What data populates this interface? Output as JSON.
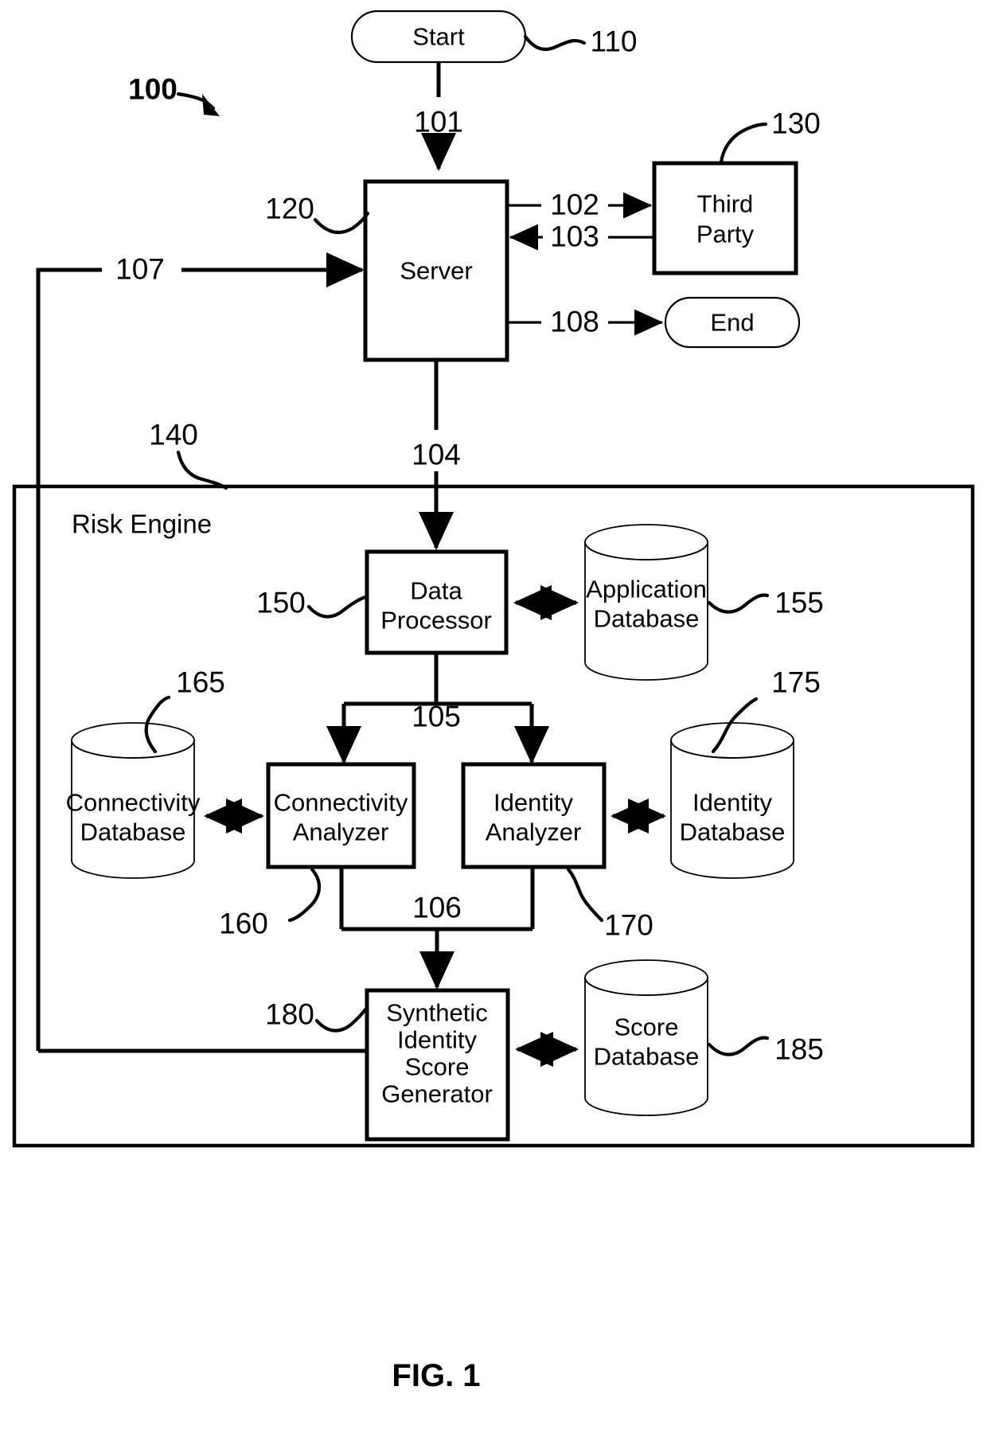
{
  "figure": {
    "caption": "FIG. 1",
    "system_reference": "100"
  },
  "nodes": {
    "start": {
      "label": "Start",
      "ref": "110",
      "shape": "terminator"
    },
    "server": {
      "label": "Server",
      "ref": "120",
      "shape": "rectangle"
    },
    "third_party": {
      "label_line1": "Third",
      "label_line2": "Party",
      "ref": "130",
      "shape": "rectangle"
    },
    "end": {
      "label": "End",
      "ref": "",
      "shape": "terminator"
    },
    "risk_engine": {
      "label": "Risk Engine",
      "ref": "140",
      "shape": "container"
    },
    "data_processor": {
      "label_line1": "Data",
      "label_line2": "Processor",
      "ref": "150",
      "shape": "rectangle"
    },
    "application_database": {
      "label_line1": "Application",
      "label_line2": "Database",
      "ref": "155",
      "shape": "cylinder"
    },
    "connectivity_database": {
      "label_line1": "Connectivity",
      "label_line2": "Database",
      "ref": "165",
      "shape": "cylinder"
    },
    "connectivity_analyzer": {
      "label_line1": "Connectivity",
      "label_line2": "Analyzer",
      "ref": "160",
      "shape": "rectangle"
    },
    "identity_analyzer": {
      "label_line1": "Identity",
      "label_line2": "Analyzer",
      "ref": "170",
      "shape": "rectangle"
    },
    "identity_database": {
      "label_line1": "Identity",
      "label_line2": "Database",
      "ref": "175",
      "shape": "cylinder"
    },
    "synthetic_score_generator": {
      "label_line1": "Synthetic",
      "label_line2": "Identity",
      "label_line3": "Score",
      "label_line4": "Generator",
      "ref": "180",
      "shape": "rectangle"
    },
    "score_database": {
      "label_line1": "Score",
      "label_line2": "Database",
      "ref": "185",
      "shape": "cylinder"
    }
  },
  "flows": {
    "f101": {
      "label": "101",
      "from": "start",
      "to": "server"
    },
    "f102": {
      "label": "102",
      "from": "server",
      "to": "third_party"
    },
    "f103": {
      "label": "103",
      "from": "third_party",
      "to": "server"
    },
    "f104": {
      "label": "104",
      "from": "server",
      "to": "data_processor"
    },
    "f105": {
      "label": "105",
      "from": "data_processor",
      "to": "analyzers"
    },
    "f106": {
      "label": "106",
      "from": "analyzers",
      "to": "synthetic_score_generator"
    },
    "f107": {
      "label": "107",
      "from": "synthetic_score_generator",
      "to": "server"
    },
    "f108": {
      "label": "108",
      "from": "server",
      "to": "end"
    }
  },
  "colors": {
    "stroke": "#000000",
    "fill": "#ffffff"
  }
}
